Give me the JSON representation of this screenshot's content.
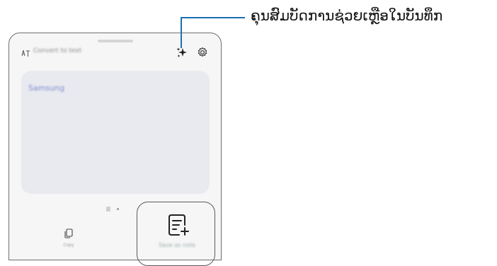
{
  "callout": {
    "text": "ຄຸນສົມບັດການຊ່ວຍເຫຼືອໃນບັນທຶກ"
  },
  "panel": {
    "header_label": "Convert to text",
    "card_text": "Samsung",
    "copy_label": "Copy",
    "save_label": "Save as note",
    "icons": [
      "convert-icon",
      "sparkle-icon",
      "gear-icon",
      "copy-icon",
      "note-add-icon"
    ]
  },
  "colors": {
    "accent_line": "#1b6fb3",
    "card_bg": "#e9eaef",
    "card_text": "#7f8bd3"
  }
}
